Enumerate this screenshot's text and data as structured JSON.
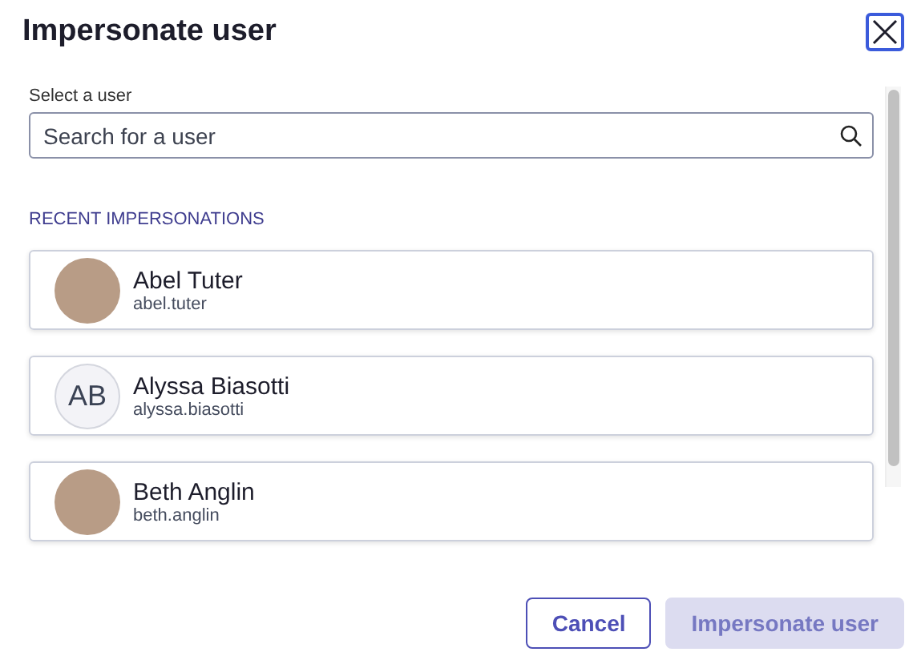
{
  "dialog": {
    "title": "Impersonate user"
  },
  "search": {
    "label": "Select a user",
    "placeholder": "Search for a user"
  },
  "recent": {
    "heading": "RECENT IMPERSONATIONS",
    "users": [
      {
        "name": "Abel Tuter",
        "username": "abel.tuter",
        "avatar": {
          "kind": "photo"
        }
      },
      {
        "name": "Alyssa Biasotti",
        "username": "alyssa.biasotti",
        "avatar": {
          "kind": "initials",
          "initials": "AB"
        }
      },
      {
        "name": "Beth Anglin",
        "username": "beth.anglin",
        "avatar": {
          "kind": "photo"
        }
      }
    ]
  },
  "buttons": [
    {
      "label": "Cancel",
      "kind": "secondary",
      "disabled": false
    },
    {
      "label": "Impersonate user",
      "kind": "primary",
      "disabled": true
    }
  ]
}
